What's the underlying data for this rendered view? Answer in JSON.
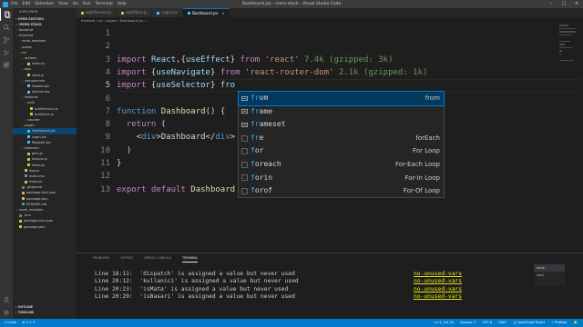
{
  "window": {
    "title": "Dashboard.jsx - mern-stack - Visual Studio Code",
    "menu": [
      "File",
      "Edit",
      "Selection",
      "View",
      "Go",
      "Run",
      "Terminal",
      "Help"
    ],
    "controls": [
      "–",
      "▢",
      "✕"
    ]
  },
  "sidebar": {
    "header": "EXPLORER",
    "open_editors": "OPEN EDITORS",
    "project": "MERN-STACK",
    "tree": [
      {
        "label": "backend",
        "depth": 1,
        "folder": true,
        "open": false,
        "color": "#cccccc"
      },
      {
        "label": "frontend",
        "depth": 1,
        "folder": true,
        "open": true,
        "color": "#e2c08d"
      },
      {
        "label": "node_modules",
        "depth": 2,
        "folder": true,
        "open": false,
        "color": "#cccccc"
      },
      {
        "label": "public",
        "depth": 2,
        "folder": true,
        "open": false,
        "color": "#cccccc"
      },
      {
        "label": "src",
        "depth": 2,
        "folder": true,
        "open": true,
        "color": "#e2c08d"
      },
      {
        "label": "actions",
        "depth": 3,
        "folder": true,
        "open": true,
        "color": "#cccccc"
      },
      {
        "label": "index.js",
        "depth": 4,
        "folder": false,
        "color": "#cccccc"
      },
      {
        "label": "app",
        "depth": 3,
        "folder": true,
        "open": true,
        "color": "#cccccc"
      },
      {
        "label": "store.js",
        "depth": 4,
        "folder": false,
        "color": "#cccccc"
      },
      {
        "label": "components",
        "depth": 3,
        "folder": true,
        "open": true,
        "color": "#cccccc"
      },
      {
        "label": "Header.jsx",
        "depth": 4,
        "folder": false,
        "color": "#cccccc"
      },
      {
        "label": "Spinner.jsx",
        "depth": 4,
        "folder": false,
        "color": "#cccccc"
      },
      {
        "label": "features",
        "depth": 3,
        "folder": true,
        "open": true,
        "color": "#cccccc"
      },
      {
        "label": "auth",
        "depth": 4,
        "folder": true,
        "open": true,
        "color": "#cccccc"
      },
      {
        "label": "authService.js",
        "depth": 5,
        "folder": false,
        "color": "#cccccc"
      },
      {
        "label": "authSlice.js",
        "depth": 5,
        "folder": false,
        "color": "#cccccc"
      },
      {
        "label": "counter",
        "depth": 4,
        "folder": true,
        "open": false,
        "color": "#cccccc"
      },
      {
        "label": "pages",
        "depth": 3,
        "folder": true,
        "open": true,
        "color": "#e2c08d"
      },
      {
        "label": "Dashboard.jsx",
        "depth": 4,
        "folder": false,
        "color": "#e2c08d",
        "selected": true
      },
      {
        "label": "Login.jsx",
        "depth": 4,
        "folder": false,
        "color": "#cccccc"
      },
      {
        "label": "Register.jsx",
        "depth": 4,
        "folder": false,
        "color": "#cccccc"
      },
      {
        "label": "reducers",
        "depth": 3,
        "folder": true,
        "open": true,
        "color": "#cccccc"
      },
      {
        "label": "gers.js",
        "depth": 4,
        "folder": false,
        "color": "#cccccc"
      },
      {
        "label": "locayla.js",
        "depth": 4,
        "folder": false,
        "color": "#cccccc"
      },
      {
        "label": "index.js",
        "depth": 4,
        "folder": false,
        "color": "#cccccc"
      },
      {
        "label": "App.js",
        "depth": 3,
        "folder": false,
        "color": "#cccccc"
      },
      {
        "label": "index.css",
        "depth": 3,
        "folder": false,
        "color": "#cccccc"
      },
      {
        "label": "index.js",
        "depth": 3,
        "folder": false,
        "color": "#cccccc"
      },
      {
        "label": ".gitignore",
        "depth": 2,
        "folder": false,
        "color": "#cccccc"
      },
      {
        "label": "package-lock.json",
        "depth": 2,
        "folder": false,
        "color": "#cccccc"
      },
      {
        "label": "package.json",
        "depth": 2,
        "folder": false,
        "color": "#cccccc"
      },
      {
        "label": "README.md",
        "depth": 2,
        "folder": false,
        "color": "#cccccc"
      },
      {
        "label": "node_modules",
        "depth": 1,
        "folder": true,
        "open": false,
        "color": "#cccccc"
      },
      {
        "label": ".env",
        "depth": 1,
        "folder": false,
        "color": "#cccccc"
      },
      {
        "label": "package-lock.json",
        "depth": 1,
        "folder": false,
        "color": "#cccccc"
      },
      {
        "label": "package.json",
        "depth": 1,
        "folder": false,
        "color": "#cccccc"
      }
    ],
    "outline": "OUTLINE",
    "timeline": "TIMELINE"
  },
  "tabs": [
    {
      "label": "authService.js",
      "active": false
    },
    {
      "label": "authSlice.js",
      "active": false
    },
    {
      "label": "Login.jsx",
      "active": false
    },
    {
      "label": "Dashboard.jsx",
      "active": true
    }
  ],
  "breadcrumb": "frontend  ›  src  ›  pages  ›  Dashboard.jsx  ›  ...",
  "editor": {
    "current_line": 5,
    "lines": [
      {
        "n": "1",
        "html": ""
      },
      {
        "n": "2",
        "html": ""
      },
      {
        "n": "3",
        "html": "<span class=\"kw\">import</span> <span class=\"var\">React</span>,{<span class=\"var\">useEffect</span>} <span class=\"kw\">from</span> <span class=\"str\">'react'</span> <span class=\"cmt\">7.4k (gzipped: 3k)</span>"
      },
      {
        "n": "4",
        "html": "<span class=\"kw\">import</span> {<span class=\"var\">useNavigate</span>} <span class=\"kw\">from</span> <span class=\"str\">'react-router-dom'</span> <span class=\"cmt\">2.1k (gzipped: 1k)</span>"
      },
      {
        "n": "5",
        "html": "<span class=\"kw\">import</span> {<span class=\"var\">useSelector</span>} <span class=\"var\">fro</span>"
      },
      {
        "n": "6",
        "html": ""
      },
      {
        "n": "7",
        "html": "<span class=\"kw2\">function</span> <span class=\"fn\">Dashboard</span>() {"
      },
      {
        "n": "8",
        "html": "  <span class=\"kw\">return</span> ("
      },
      {
        "n": "9",
        "html": "    &lt;<span class=\"tag\">div</span>&gt;Dashboard&lt;/<span class=\"tag\">div</span>&gt;"
      },
      {
        "n": "10",
        "html": "  )"
      },
      {
        "n": "11",
        "html": "}"
      },
      {
        "n": "12",
        "html": ""
      },
      {
        "n": "13",
        "html": "<span class=\"kw\">export</span> <span class=\"kw\">default</span> <span class=\"fn\">Dashboard</span>"
      }
    ]
  },
  "suggest": [
    {
      "match": "fr",
      "rest": "om",
      "detail": "from",
      "kind": "keyword",
      "selected": true
    },
    {
      "match": "fr",
      "rest": "ame",
      "detail": "",
      "kind": "keyword"
    },
    {
      "match": "fr",
      "rest": "ameset",
      "detail": "",
      "kind": "keyword"
    },
    {
      "match": "fr",
      "rest": "e",
      "detail": "forEach",
      "kind": "snippet"
    },
    {
      "match": "f",
      "rest": "or",
      "detail": "For Loop",
      "kind": "snippet"
    },
    {
      "match": "f",
      "rest": "oreach",
      "detail": "For-Each Loop",
      "kind": "snippet"
    },
    {
      "match": "f",
      "rest": "orin",
      "detail": "For-In Loop",
      "kind": "snippet"
    },
    {
      "match": "f",
      "rest": "orof",
      "detail": "For-Of Loop",
      "kind": "snippet"
    }
  ],
  "panel": {
    "tabs": [
      "PROBLEMS",
      "OUTPUT",
      "DEBUG CONSOLE",
      "TERMINAL"
    ],
    "active_tab": "TERMINAL",
    "lines": [
      {
        "loc": "Line 18:11:",
        "msg": "'dispatch' is assigned a value but never used",
        "rule": "no-unused-vars"
      },
      {
        "loc": "Line 20:12:",
        "msg": "'kullanici' is assigned a value but never used",
        "rule": "no-unused-vars"
      },
      {
        "loc": "Line 20:23:",
        "msg": "'isMata' is assigned a value but never used",
        "rule": "no-unused-vars"
      },
      {
        "loc": "Line 20:29:",
        "msg": "'isBasari' is assigned a value but never used",
        "rule": "no-unused-vars"
      }
    ],
    "terminals": [
      "node",
      "cmd"
    ]
  },
  "statusbar": {
    "left": [
      "⎇ main",
      "⊗ 0  ⚠ 0"
    ],
    "right": [
      "Ln 5, Col 25",
      "Spaces: 2",
      "UTF-8",
      "CRLF",
      "{} JavaScript React",
      "✓ Prettier",
      "🔔"
    ]
  }
}
